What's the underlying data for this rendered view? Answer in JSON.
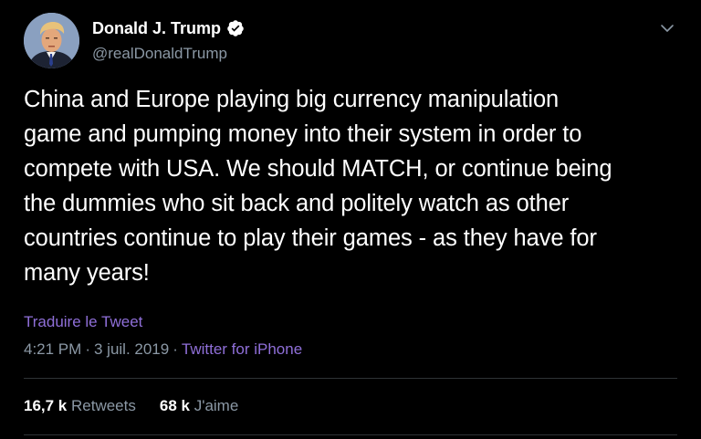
{
  "author": {
    "display_name": "Donald J. Trump",
    "handle": "@realDonaldTrump",
    "verified": true,
    "avatar_icon": "profile-photo-avatar"
  },
  "tweet": {
    "text": "China and Europe playing big currency manipulation\ngame and pumping money into their system in order to\ncompete with USA. We should MATCH, or continue being\nthe dummies who sit back and politely watch as other\ncountries continue to play their games - as they have for\nmany years!",
    "translate_label": "Traduire le Tweet",
    "time": "4:21 PM",
    "separator": "·",
    "date": "3 juil. 2019",
    "source": "Twitter for iPhone"
  },
  "stats": {
    "retweets_value": "16,7 k",
    "retweets_label": "Retweets",
    "likes_value": "68 k",
    "likes_label": "J'aime"
  },
  "colors": {
    "background": "#000000",
    "text_primary": "#ffffff",
    "text_secondary": "#8b98a5",
    "link_accent": "#8f6fd8",
    "divider": "#2f3336"
  },
  "icons": {
    "verified": "verified-badge-icon",
    "menu": "chevron-down-icon"
  }
}
